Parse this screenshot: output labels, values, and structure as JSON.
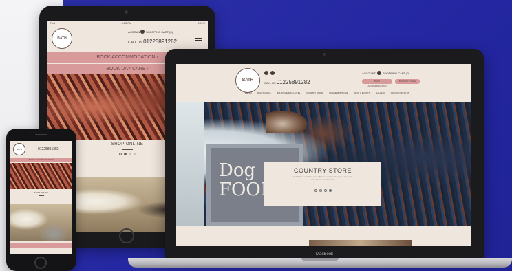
{
  "site": {
    "logo_text": "BATH",
    "account_label": "ACCOUNT",
    "cart_label": "SHOPPING CART (0)",
    "call_label": "CALL US",
    "phone_number": "01225891282"
  },
  "tablet": {
    "status_left": "iPad",
    "status_time": "4:25 PM",
    "status_right": "100%",
    "book_accommodation": "BOOK ACCOMMODATION ›",
    "book_day_care": "BOOK DAY CARE ›",
    "shop_title": "SHOP ONLINE",
    "shop_text": ""
  },
  "laptop": {
    "brand": "MacBook",
    "btn_accommodation": "BOOK ACCOMMODATION",
    "btn_day_care": "BOOK DAY CARE",
    "nav": [
      "HELLO",
      "DOG SCHOOL",
      "BOUTIQUE DOG HOTEL",
      "COUNTRY STORE",
      "ONLINE BOUTIQUE",
      "BLOG & EVENTS",
      "GALLERY",
      "CONTACT FIND US"
    ],
    "sign_text_line1": "Dog",
    "sign_text_line2": "FOOD",
    "card_title": "COUNTRY STORE",
    "card_text": "Our little on-site farm shop offers a selection of goodies for dogs, cats, horses and humans."
  },
  "phone": {
    "book_label": "BOOK ACCOMMODATION",
    "shop_title": "SHOP ONLINE"
  }
}
